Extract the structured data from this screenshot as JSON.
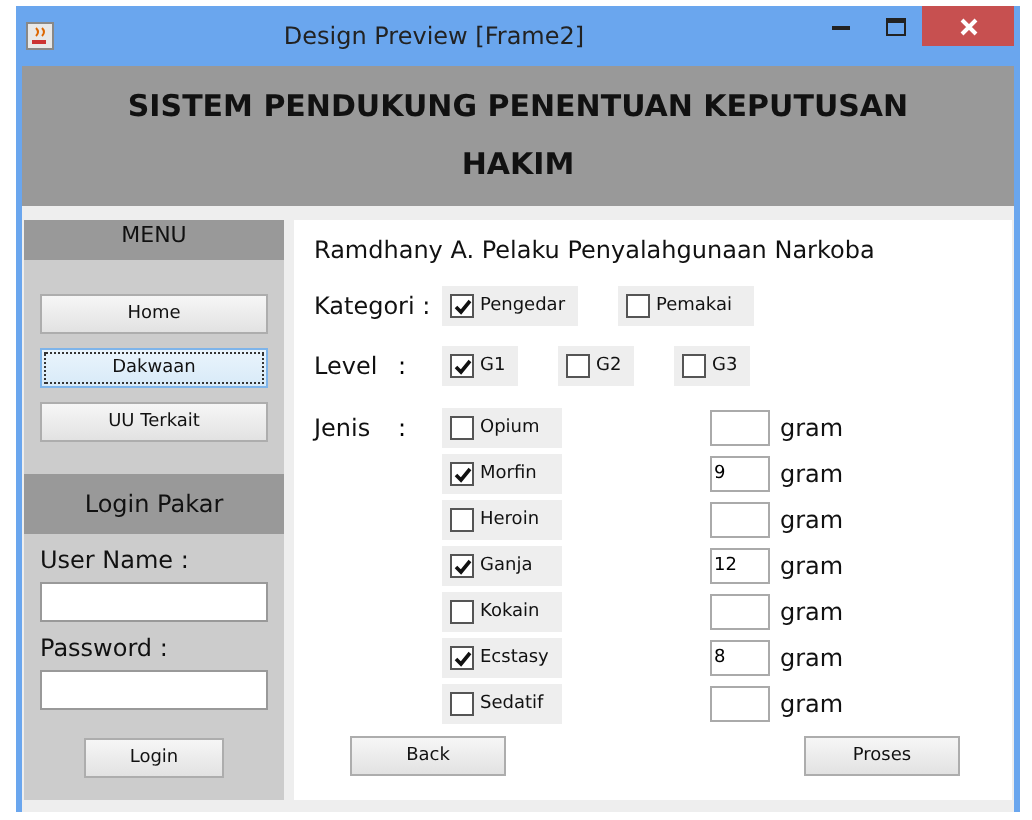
{
  "window": {
    "title": "Design Preview [Frame2]"
  },
  "header": {
    "title": "SISTEM PENDUKUNG PENENTUAN KEPUTUSAN HAKIM"
  },
  "sidebar": {
    "menu_title": "MENU",
    "menu_buttons": [
      {
        "label": "Home",
        "focused": false
      },
      {
        "label": "Dakwaan",
        "focused": true
      },
      {
        "label": "UU Terkait",
        "focused": false
      }
    ],
    "login_title": "Login Pakar",
    "username_label": "User Name :",
    "password_label": "Password :",
    "login_button": "Login"
  },
  "main": {
    "case_title": "Ramdhany A. Pelaku Penyalahgunaan Narkoba",
    "kategori": {
      "label": "Kategori :",
      "options": [
        {
          "label": "Pengedar",
          "checked": true
        },
        {
          "label": "Pemakai",
          "checked": false
        }
      ]
    },
    "level": {
      "label": "Level",
      "colon": ":",
      "options": [
        {
          "label": "G1",
          "checked": true
        },
        {
          "label": "G2",
          "checked": false
        },
        {
          "label": "G3",
          "checked": false
        }
      ]
    },
    "jenis": {
      "label": "Jenis",
      "colon": ":",
      "items": [
        {
          "label": "Opium",
          "checked": false,
          "unit": "gram"
        },
        {
          "label": "Morfin",
          "checked": true,
          "amount": "9",
          "unit": "gram"
        },
        {
          "label": "Heroin",
          "checked": false,
          "unit": "gram"
        },
        {
          "label": "Ganja",
          "checked": true,
          "amount": "12",
          "unit": "gram"
        },
        {
          "label": "Kokain",
          "checked": false,
          "unit": "gram"
        },
        {
          "label": "Ecstasy",
          "checked": true,
          "amount": "8",
          "unit": "gram"
        },
        {
          "label": "Sedatif",
          "checked": false,
          "unit": "gram"
        }
      ]
    },
    "buttons": [
      "Back",
      "Proses"
    ]
  }
}
